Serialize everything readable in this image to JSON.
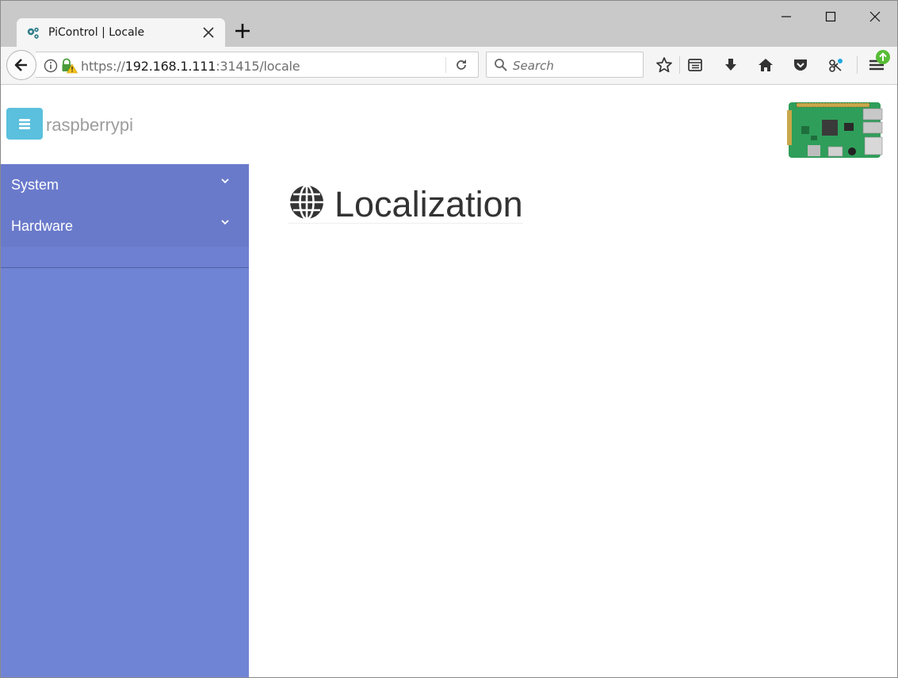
{
  "browser": {
    "tab_title": "PiControl | Locale",
    "url": {
      "scheme": "https://",
      "host": "192.168.1.111",
      "rest": ":31415/locale"
    },
    "search_placeholder": "Search"
  },
  "app": {
    "brand": "raspberrypi",
    "sidebar": {
      "items": [
        {
          "label": "System"
        },
        {
          "label": "Hardware"
        }
      ]
    },
    "page": {
      "title": "Localization"
    }
  },
  "colors": {
    "sidebar_bg": "#7084d6",
    "sidebar_item_bg": "#6a7acb",
    "menu_toggle": "#5bc0de",
    "brand_text": "#9d9d9d"
  }
}
